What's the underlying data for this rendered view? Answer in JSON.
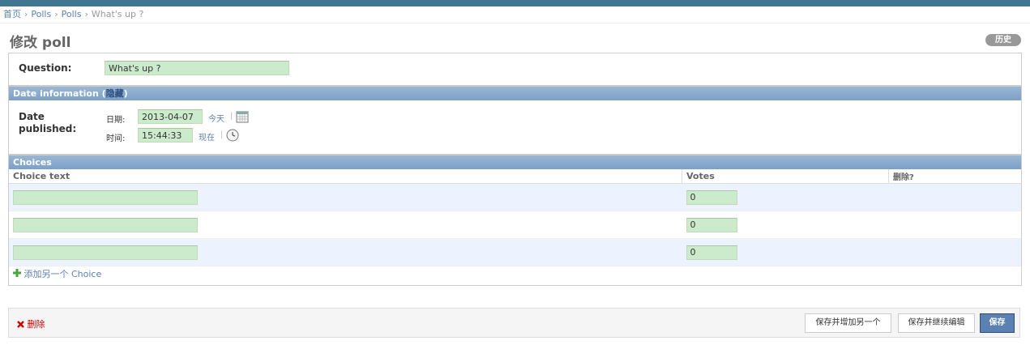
{
  "breadcrumb": {
    "home": "首页",
    "app": "Polls",
    "model": "Polls",
    "current": "What's up ?",
    "separator": "›"
  },
  "page_title": "修改 poll",
  "history_button": "历史",
  "question": {
    "label": "Question:",
    "value": "What's up ?"
  },
  "date_section": {
    "title": "Date information",
    "toggle_open": "(",
    "toggle_label": "隐藏",
    "toggle_close": ")",
    "field_label_line1": "Date",
    "field_label_line2": "published:",
    "date_label": "日期:",
    "date_value": "2013-04-07",
    "today_link": "今天",
    "time_label": "时间:",
    "time_value": "15:44:33",
    "now_link": "现在",
    "pipe": "|"
  },
  "choices_section": {
    "title": "Choices",
    "headers": [
      "Choice text",
      "Votes",
      "删除?"
    ],
    "rows": [
      {
        "choice_text": "",
        "votes": "0"
      },
      {
        "choice_text": "",
        "votes": "0"
      },
      {
        "choice_text": "",
        "votes": "0"
      }
    ],
    "add_link": "添加另一个 Choice"
  },
  "submit_row": {
    "delete_link": "删除",
    "save_add_another": "保存并增加另一个",
    "save_continue": "保存并继续编辑",
    "save": "保存"
  },
  "colors": {
    "header_bar": "#417690",
    "section_header": "#7ca0c7",
    "input_bg": "#ccebcc",
    "row_alt": "#edf3fe",
    "link": "#5b80b2",
    "delete": "#cc0000"
  }
}
